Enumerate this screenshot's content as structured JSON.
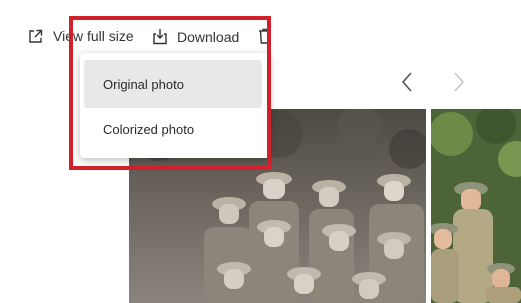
{
  "toolbar": {
    "view_full_label": "View full size",
    "download_label": "Download",
    "view_full_icon": "external-link-icon",
    "download_icon": "download-icon",
    "delete_icon": "trash-icon"
  },
  "download_menu": {
    "items": [
      {
        "label": "Original photo",
        "selected": true
      },
      {
        "label": "Colorized photo",
        "selected": false
      }
    ]
  },
  "gallery": {
    "prev_icon": "chevron-left-icon",
    "next_icon": "chevron-right-icon",
    "photos": [
      "original",
      "colorized"
    ]
  },
  "colors": {
    "highlight": "#d0202a",
    "menu_selected_bg": "#e8e8e8",
    "colorized_vegetation": "#55683f"
  }
}
